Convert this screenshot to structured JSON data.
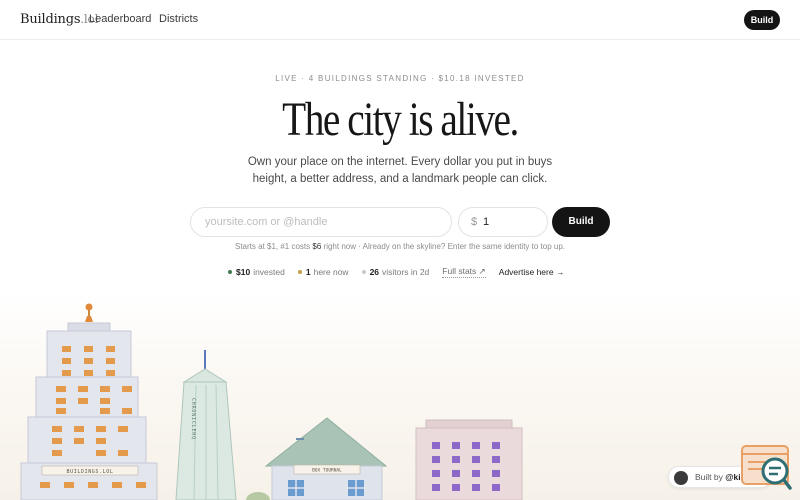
{
  "header": {
    "logo_main": "Buildings",
    "logo_tld": ".lol",
    "nav": [
      "Leaderboard",
      "Districts"
    ],
    "build_label": "Build"
  },
  "hero": {
    "kicker": "LIVE · 4 BUILDINGS STANDING · $10.18 INVESTED",
    "title": "The city is alive.",
    "subtitle": "Own your place on the internet. Every dollar you put in buys height, a better address, and a landmark people can click."
  },
  "form": {
    "site_placeholder": "yoursite.com or @handle",
    "currency_symbol": "$",
    "amount_value": "1",
    "submit_label": "Build",
    "hint_prefix": "Starts at $1, #1 costs",
    "hint_amount": "$6",
    "hint_suffix": "right now · Already on the skyline? Enter the same identity to top up."
  },
  "stats": {
    "invested_value": "$10",
    "invested_label": "invested",
    "here_value": "1",
    "here_label": "here now",
    "visitors_value": "26",
    "visitors_label": "visitors in 2d",
    "full_stats_label": "Full stats ↗",
    "advertise_label": "Advertise here →"
  },
  "city": {
    "tower_sign": "BUILDINGS.LOL",
    "spire_label": "CHRONICLEHQ",
    "house_sign": "BOX TOURNAL"
  },
  "badge": {
    "prefix": "Built by",
    "handle": "@kiaan_n"
  },
  "colors": {
    "accent_dark": "#141414",
    "dot_invested": "#3e7a52",
    "dot_here": "#c2a146",
    "dot_visitors": "#c9c9c9",
    "widget_orange": "#e8a066",
    "widget_teal": "#2e6f73"
  }
}
